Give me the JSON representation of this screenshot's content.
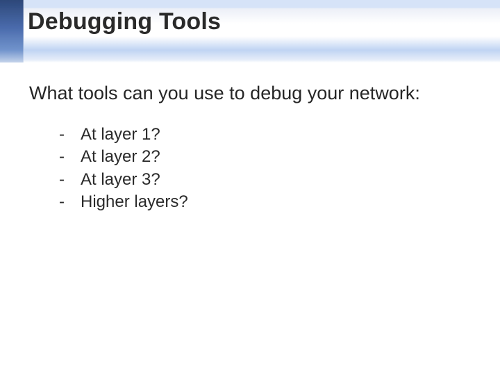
{
  "slide": {
    "title": "Debugging Tools",
    "lead": "What tools can you use to debug your network:",
    "items": [
      {
        "bullet": "-",
        "text": "At layer 1?"
      },
      {
        "bullet": "-",
        "text": "At layer 2?"
      },
      {
        "bullet": "-",
        "text": "At layer 3?"
      },
      {
        "bullet": "-",
        "text": "Higher layers?"
      }
    ]
  }
}
